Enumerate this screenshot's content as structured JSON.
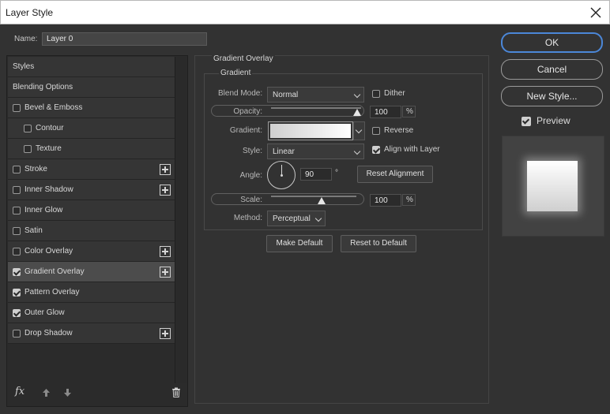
{
  "window": {
    "title": "Layer Style"
  },
  "name_field": {
    "label": "Name:",
    "value": "Layer 0"
  },
  "styles_list": {
    "items": [
      {
        "label": "Styles",
        "checkbox": false,
        "checked": false,
        "indent": 0,
        "plus": false,
        "selected": false
      },
      {
        "label": "Blending Options",
        "checkbox": false,
        "checked": false,
        "indent": 0,
        "plus": false,
        "selected": false
      },
      {
        "label": "Bevel & Emboss",
        "checkbox": true,
        "checked": false,
        "indent": 0,
        "plus": false,
        "selected": false
      },
      {
        "label": "Contour",
        "checkbox": true,
        "checked": false,
        "indent": 1,
        "plus": false,
        "selected": false
      },
      {
        "label": "Texture",
        "checkbox": true,
        "checked": false,
        "indent": 1,
        "plus": false,
        "selected": false
      },
      {
        "label": "Stroke",
        "checkbox": true,
        "checked": false,
        "indent": 0,
        "plus": true,
        "selected": false
      },
      {
        "label": "Inner Shadow",
        "checkbox": true,
        "checked": false,
        "indent": 0,
        "plus": true,
        "selected": false
      },
      {
        "label": "Inner Glow",
        "checkbox": true,
        "checked": false,
        "indent": 0,
        "plus": false,
        "selected": false
      },
      {
        "label": "Satin",
        "checkbox": true,
        "checked": false,
        "indent": 0,
        "plus": false,
        "selected": false
      },
      {
        "label": "Color Overlay",
        "checkbox": true,
        "checked": false,
        "indent": 0,
        "plus": true,
        "selected": false
      },
      {
        "label": "Gradient Overlay",
        "checkbox": true,
        "checked": true,
        "indent": 0,
        "plus": true,
        "selected": true
      },
      {
        "label": "Pattern Overlay",
        "checkbox": true,
        "checked": true,
        "indent": 0,
        "plus": false,
        "selected": false
      },
      {
        "label": "Outer Glow",
        "checkbox": true,
        "checked": true,
        "indent": 0,
        "plus": false,
        "selected": false
      },
      {
        "label": "Drop Shadow",
        "checkbox": true,
        "checked": false,
        "indent": 0,
        "plus": true,
        "selected": false
      }
    ],
    "footer": {
      "fx_label": "fx",
      "up_icon": "arrow-up-icon",
      "down_icon": "arrow-down-icon",
      "trash_icon": "trash-icon"
    }
  },
  "gradient_overlay": {
    "section_title": "Gradient Overlay",
    "group_title": "Gradient",
    "blend_mode": {
      "label": "Blend Mode:",
      "value": "Normal"
    },
    "dither": {
      "label": "Dither",
      "checked": false
    },
    "opacity": {
      "label": "Opacity:",
      "value": "100",
      "unit": "%",
      "level": 1.0
    },
    "gradient": {
      "label": "Gradient:",
      "start_color": "#cfcfcf",
      "end_color": "#ffffff"
    },
    "reverse": {
      "label": "Reverse",
      "checked": false
    },
    "style": {
      "label": "Style:",
      "value": "Linear"
    },
    "align_with_layer": {
      "label": "Align with Layer",
      "checked": true
    },
    "angle": {
      "label": "Angle:",
      "value": "90",
      "unit": "°"
    },
    "reset_alignment": "Reset Alignment",
    "scale": {
      "label": "Scale:",
      "value": "100",
      "unit": "%",
      "level": 0.6
    },
    "method": {
      "label": "Method:",
      "value": "Perceptual"
    },
    "make_default": "Make Default",
    "reset_to_default": "Reset to Default"
  },
  "dialog_buttons": {
    "ok": "OK",
    "cancel": "Cancel",
    "new_style": "New Style...",
    "preview_label": "Preview",
    "preview_checked": true
  },
  "colors": {
    "accent": "#4b87d8",
    "panel_bg": "#323232",
    "selected_row": "#4c4c4c"
  }
}
